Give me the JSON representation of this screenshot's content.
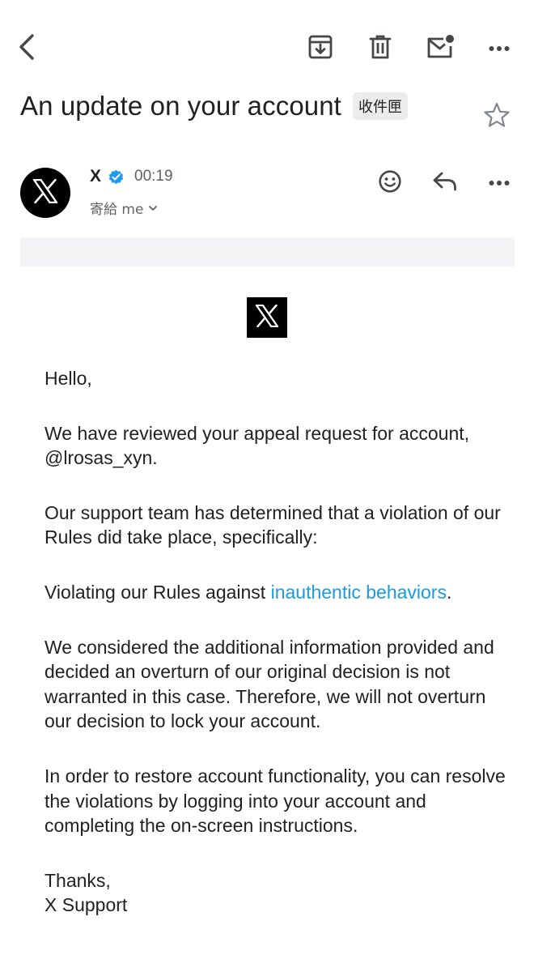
{
  "toolbar": {
    "back_icon": "back-arrow-icon",
    "archive_icon": "archive-icon",
    "delete_icon": "trash-icon",
    "mark_unread_icon": "mark-unread-icon",
    "more_icon": "more-horizontal-icon"
  },
  "email": {
    "subject": "An update on your account",
    "label": "收件匣",
    "starred": false,
    "sender": {
      "name": "X",
      "verified": true,
      "time": "00:19",
      "recipient": "寄給 me"
    }
  },
  "actions": {
    "react_icon": "smiley-icon",
    "reply_icon": "reply-icon",
    "more_icon": "more-horizontal-icon"
  },
  "body": {
    "greeting": "Hello,",
    "p1": "We have reviewed your appeal request for account, @lrosas_xyn.",
    "p2": "Our support team has determined that a violation of our Rules did take place, specifically:",
    "p3_prefix": "Violating our Rules against ",
    "p3_link": "inauthentic behaviors",
    "p3_suffix": ".",
    "p4": "We considered the additional information provided and decided an overturn of our original decision is not warranted in this case. Therefore, we will not overturn our decision to lock your account.",
    "p5": "In order to restore account functionality, you can resolve the violations by logging into your account and completing the on-screen instructions.",
    "closing_1": "Thanks,",
    "closing_2": "X Support"
  },
  "colors": {
    "link": "#1a9ae0",
    "verified_badge": "#1d9bf0",
    "banner": "#f1f3f4",
    "icon": "#444746"
  }
}
